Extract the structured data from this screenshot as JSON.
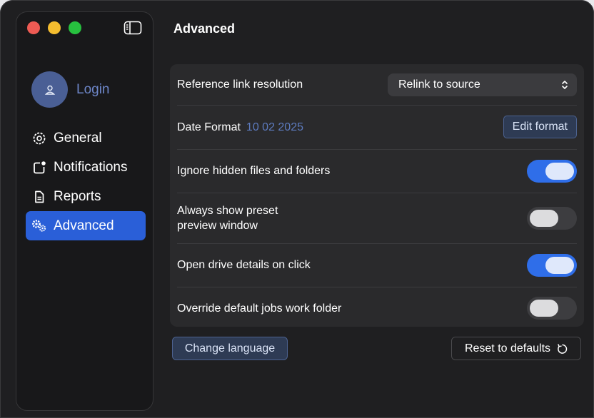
{
  "window": {
    "traffic_lights": [
      "close",
      "minimize",
      "zoom"
    ]
  },
  "sidebar": {
    "toggle_icon": "sidebar-left-icon",
    "login": {
      "label": "Login",
      "icon": "person-icon"
    },
    "items": [
      {
        "label": "General",
        "icon": "gear-icon",
        "active": false
      },
      {
        "label": "Notifications",
        "icon": "notification-badge-icon",
        "active": false
      },
      {
        "label": "Reports",
        "icon": "document-icon",
        "active": false
      },
      {
        "label": "Advanced",
        "icon": "gears-icon",
        "active": true
      }
    ]
  },
  "main": {
    "title": "Advanced",
    "settings": {
      "reference_link": {
        "label": "Reference link resolution",
        "selected": "Relink to source"
      },
      "date_format": {
        "label": "Date Format",
        "value": "10 02 2025",
        "button": "Edit format"
      },
      "ignore_hidden": {
        "label": "Ignore hidden files and folders",
        "enabled": true
      },
      "preset_preview": {
        "label_line1": "Always show preset",
        "label_line2": "preview window",
        "enabled": false
      },
      "drive_details": {
        "label": "Open drive details on click",
        "enabled": true
      },
      "override_jobs": {
        "label": "Override default jobs work folder",
        "enabled": false
      }
    },
    "change_language": "Change language",
    "reset_defaults": "Reset to defaults"
  },
  "colors": {
    "accent": "#2a5fd8",
    "toggle_on": "#2f6ee9",
    "date_value": "#5d7bbf",
    "login_text": "#6d86c8"
  }
}
